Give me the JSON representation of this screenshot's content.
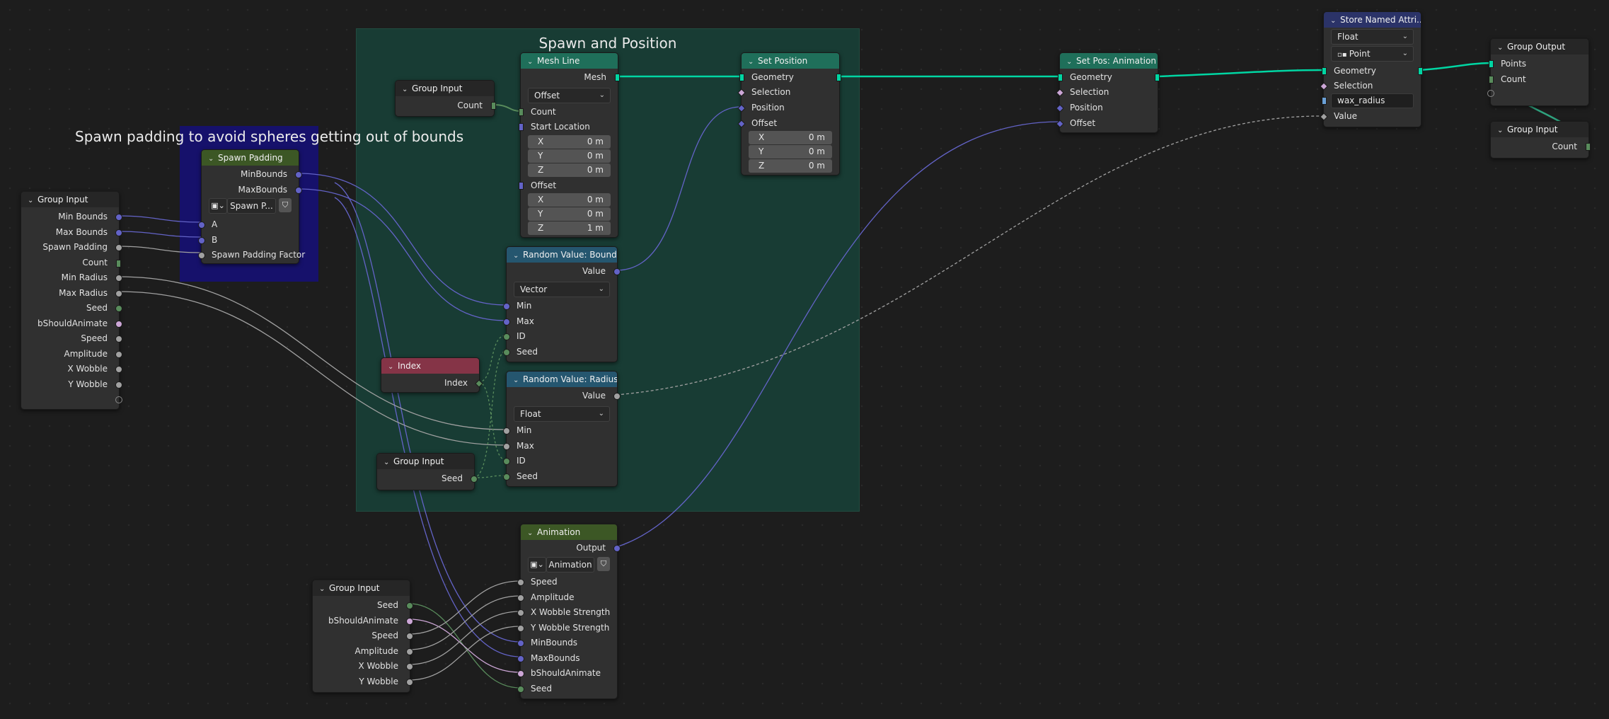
{
  "colors": {
    "background": "#1d1d1d",
    "frame_spawn": "#183c34",
    "frame_padding": "#16116b",
    "header_geometry": "#1f6f5a",
    "header_utility": "#25566f",
    "header_group": "#3c5725",
    "header_input": "#853447",
    "header_io": "#262626",
    "header_store": "#2b3368",
    "socket_geometry": "#00d6a3",
    "socket_vector": "#6363c7",
    "socket_float": "#a1a1a1",
    "socket_int": "#598c5c",
    "socket_bool": "#cca6d6"
  },
  "frames": {
    "spawn": {
      "label": "Spawn and Position"
    },
    "padding_comment": "Spawn padding to avoid spheres getting out of bounds"
  },
  "nodes": {
    "group_input_left": {
      "title": "Group Input",
      "outputs": [
        "Min Bounds",
        "Max Bounds",
        "Spawn Padding",
        "Count",
        "Min Radius",
        "Max Radius",
        "Seed",
        "bShouldAnimate",
        "Speed",
        "Amplitude",
        "X Wobble",
        "Y Wobble"
      ]
    },
    "spawn_padding": {
      "title": "Spawn Padding",
      "outputs": [
        "MinBounds",
        "MaxBounds"
      ],
      "group_name": "Spawn P...",
      "inputs": [
        "A",
        "B",
        "Spawn Padding Factor"
      ]
    },
    "group_input_count": {
      "title": "Group Input",
      "output": "Count"
    },
    "mesh_line": {
      "title": "Mesh Line",
      "output": "Mesh",
      "mode": "Offset",
      "inputs": [
        "Count",
        "Start Location",
        "Offset"
      ],
      "start_location": [
        {
          "axis": "X",
          "value": "0 m"
        },
        {
          "axis": "Y",
          "value": "0 m"
        },
        {
          "axis": "Z",
          "value": "0 m"
        }
      ],
      "offset": [
        {
          "axis": "X",
          "value": "0 m"
        },
        {
          "axis": "Y",
          "value": "0 m"
        },
        {
          "axis": "Z",
          "value": "1 m"
        }
      ]
    },
    "random_bounds": {
      "title": "Random Value: Bounds",
      "output": "Value",
      "type": "Vector",
      "inputs": [
        "Min",
        "Max",
        "ID",
        "Seed"
      ]
    },
    "index": {
      "title": "Index",
      "output": "Index"
    },
    "random_radius": {
      "title": "Random Value: Radius",
      "output": "Value",
      "type": "Float",
      "inputs": [
        "Min",
        "Max",
        "ID",
        "Seed"
      ]
    },
    "group_input_seed": {
      "title": "Group Input",
      "output": "Seed"
    },
    "set_position": {
      "title": "Set Position",
      "output": "Geometry",
      "inputs": [
        "Geometry",
        "Selection",
        "Position",
        "Offset"
      ],
      "offset": [
        {
          "axis": "X",
          "value": "0 m"
        },
        {
          "axis": "Y",
          "value": "0 m"
        },
        {
          "axis": "Z",
          "value": "0 m"
        }
      ]
    },
    "set_pos_anim": {
      "title": "Set Pos: Animation",
      "output": "Geometry",
      "inputs": [
        "Geometry",
        "Selection",
        "Position",
        "Offset"
      ]
    },
    "store_named": {
      "title": "Store Named Attri...",
      "data_type": "Float",
      "domain": "Point",
      "inputs": [
        "Geometry",
        "Selection"
      ],
      "name_value": "wax_radius",
      "value_label": "Value"
    },
    "group_output": {
      "title": "Group Output",
      "inputs": [
        "Points",
        "Count"
      ]
    },
    "group_input_right": {
      "title": "Group Input",
      "output": "Count"
    },
    "animation": {
      "title": "Animation",
      "output": "Output",
      "group_name": "Animation",
      "inputs": [
        "Speed",
        "Amplitude",
        "X Wobble Strength",
        "Y Wobble Strength",
        "MinBounds",
        "MaxBounds",
        "bShouldAnimate",
        "Seed"
      ]
    },
    "group_input_bottom": {
      "title": "Group Input",
      "outputs": [
        "Seed",
        "bShouldAnimate",
        "Speed",
        "Amplitude",
        "X Wobble",
        "Y Wobble"
      ]
    }
  },
  "icons": {
    "collapse": "chevron-down-icon",
    "node_group": "node-group-icon",
    "fake_user": "shield-icon"
  }
}
